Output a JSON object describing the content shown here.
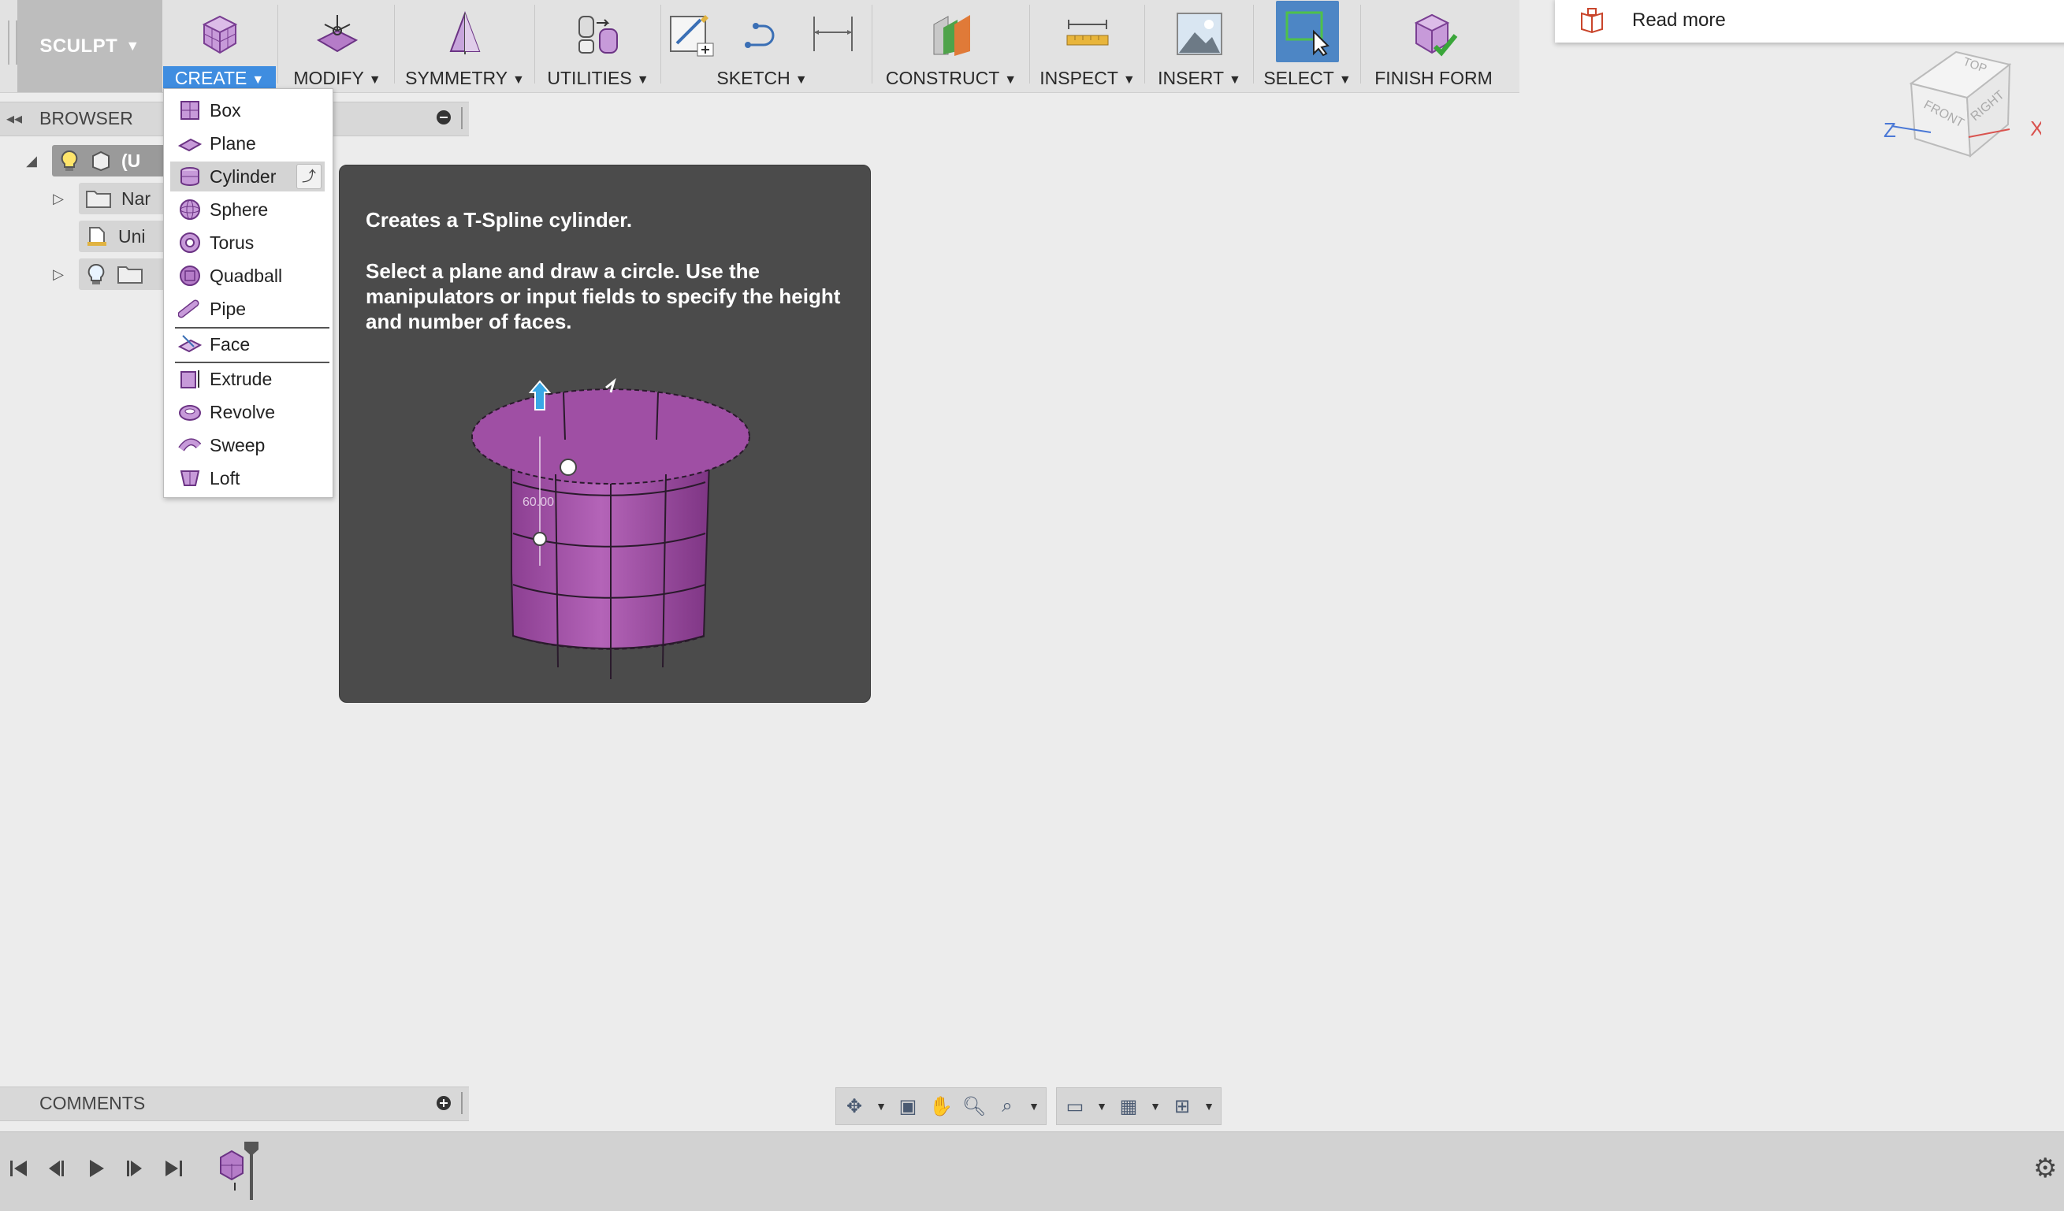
{
  "workspace": {
    "label": "SCULPT"
  },
  "toolbar": {
    "groups": [
      {
        "id": "create",
        "label": "CREATE"
      },
      {
        "id": "modify",
        "label": "MODIFY"
      },
      {
        "id": "symmetry",
        "label": "SYMMETRY"
      },
      {
        "id": "utilities",
        "label": "UTILITIES"
      },
      {
        "id": "sketch",
        "label": "SKETCH"
      },
      {
        "id": "construct",
        "label": "CONSTRUCT"
      },
      {
        "id": "inspect",
        "label": "INSPECT"
      },
      {
        "id": "insert",
        "label": "INSERT"
      },
      {
        "id": "select",
        "label": "SELECT"
      },
      {
        "id": "finish",
        "label": "FINISH FORM"
      }
    ],
    "dropdown_glyph": "▼"
  },
  "readmore": {
    "label": "Read more"
  },
  "viewcube": {
    "top": "TOP",
    "front": "FRONT",
    "right": "RIGHT",
    "axis_x": "X",
    "axis_z": "Z",
    "colors": {
      "x": "#d9534f",
      "z": "#4a78d6"
    }
  },
  "browser": {
    "title": "BROWSER",
    "rows": [
      {
        "label": "(U"
      },
      {
        "label": "Nar"
      },
      {
        "label": "Uni"
      },
      {
        "label": ""
      }
    ]
  },
  "create_menu": {
    "items": [
      {
        "label": "Box",
        "icon": "box-icon"
      },
      {
        "label": "Plane",
        "icon": "plane-icon"
      },
      {
        "label": "Cylinder",
        "icon": "cylinder-icon",
        "highlighted": true
      },
      {
        "label": "Sphere",
        "icon": "sphere-icon"
      },
      {
        "label": "Torus",
        "icon": "torus-icon"
      },
      {
        "label": "Quadball",
        "icon": "quadball-icon"
      },
      {
        "label": "Pipe",
        "icon": "pipe-icon"
      },
      {
        "label": "Face",
        "icon": "face-icon"
      },
      {
        "label": "Extrude",
        "icon": "extrude-icon"
      },
      {
        "label": "Revolve",
        "icon": "revolve-icon"
      },
      {
        "label": "Sweep",
        "icon": "sweep-icon"
      },
      {
        "label": "Loft",
        "icon": "loft-icon"
      }
    ]
  },
  "tooltip": {
    "title": "Creates a T-Spline cylinder.",
    "body": "Select a plane and draw a circle. Use the manipulators or input fields to specify the height and number of faces.",
    "dimension_label": "60.00",
    "accent": "#a24fa6"
  },
  "comments": {
    "title": "COMMENTS"
  },
  "colors": {
    "toolbar_bg": "#e2e2e2",
    "active_blue": "#3f8de0",
    "tooltip_bg": "#4b4b4b",
    "purple": "#9b59b6"
  }
}
